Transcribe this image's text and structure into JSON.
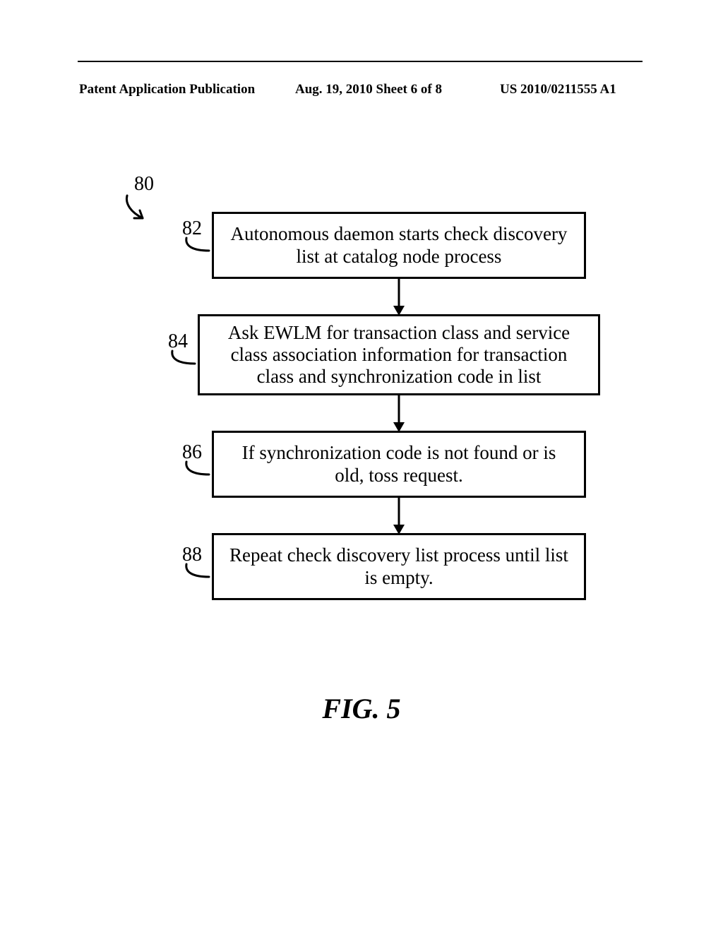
{
  "header": {
    "left": "Patent Application Publication",
    "center": "Aug. 19, 2010  Sheet 6 of 8",
    "right": "US 2010/0211555 A1"
  },
  "refs": {
    "r80": "80",
    "r82": "82",
    "r84": "84",
    "r86": "86",
    "r88": "88"
  },
  "boxes": {
    "b82": "Autonomous daemon starts check discovery list at catalog node process",
    "b84": "Ask EWLM for transaction class and service class association information for transaction class and synchronization code in list",
    "b86": "If synchronization code is not found or is old, toss request.",
    "b88": "Repeat check discovery list process until list is empty."
  },
  "figure_label": "FIG. 5",
  "chart_data": {
    "type": "flowchart",
    "label_overall": "80",
    "nodes": [
      {
        "id": "82",
        "text": "Autonomous daemon starts check discovery list at catalog node process"
      },
      {
        "id": "84",
        "text": "Ask EWLM for transaction class and service class association information for transaction class and synchronization code in list"
      },
      {
        "id": "86",
        "text": "If synchronization code is not found or is old, toss request."
      },
      {
        "id": "88",
        "text": "Repeat check discovery list process until list is empty."
      }
    ],
    "edges": [
      {
        "from": "82",
        "to": "84"
      },
      {
        "from": "84",
        "to": "86"
      },
      {
        "from": "86",
        "to": "88"
      }
    ]
  }
}
